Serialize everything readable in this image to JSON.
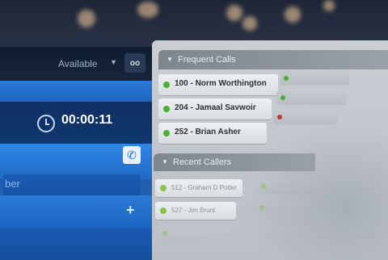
{
  "status": {
    "availability": "Available",
    "voicemail_icon": "voicemail-icon"
  },
  "call": {
    "timer": "00:00:11",
    "dial_placeholder": "ber"
  },
  "frequent_calls": {
    "header": "Frequent Calls",
    "items": [
      {
        "label": "100 - Norm Worthington",
        "status": "#4caf2f"
      },
      {
        "label": "204 - Jamaal Savwoir",
        "status": "#4caf2f"
      },
      {
        "label": "252 - Brian Asher",
        "status": "#4caf2f"
      }
    ],
    "side_items": [
      {
        "status": "#4caf2f"
      },
      {
        "status": "#4caf2f"
      },
      {
        "status": "#c0392b"
      }
    ]
  },
  "recent_callers": {
    "header": "Recent Callers",
    "items": [
      {
        "label": "512 - Graham D Potter",
        "status": "#8bc34a"
      },
      {
        "label": "527 - Jim Brunt",
        "status": "#8bc34a"
      }
    ]
  },
  "colors": {
    "accent_blue": "#1f6bc6",
    "available": "#4caf2f",
    "busy": "#c0392b"
  }
}
